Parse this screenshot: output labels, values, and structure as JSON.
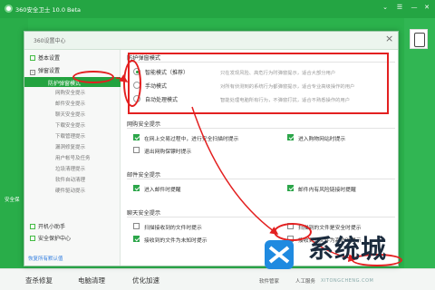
{
  "app": {
    "title": "360安全卫士",
    "version": "10.0 Beta",
    "titlebar_icons": [
      "chevron-down-icon",
      "menu-icon",
      "minimize-icon",
      "close-icon"
    ]
  },
  "left_strip_text": "安全保",
  "bottombar": {
    "items": [
      "查杀修复",
      "电脑清理",
      "优化加速"
    ],
    "right_items": [
      "软件管家",
      "人工服务"
    ]
  },
  "dialog": {
    "title": "360设置中心",
    "close": "×",
    "footer_link": "恢复所有默认值"
  },
  "sidebar": {
    "items": [
      {
        "label": "基本设置",
        "kind": "group"
      },
      {
        "label": "弹窗设置",
        "kind": "group"
      },
      {
        "label": "防护弹窗模式",
        "kind": "active"
      },
      {
        "label": "网购安全提示",
        "kind": "sub"
      },
      {
        "label": "邮件安全提示",
        "kind": "sub"
      },
      {
        "label": "聊天安全提示",
        "kind": "sub"
      },
      {
        "label": "下载安全提示",
        "kind": "sub"
      },
      {
        "label": "下载管理提示",
        "kind": "sub"
      },
      {
        "label": "漏洞修复提示",
        "kind": "sub"
      },
      {
        "label": "用户帐号及任务",
        "kind": "sub"
      },
      {
        "label": "垃圾清理提示",
        "kind": "sub"
      },
      {
        "label": "软件自动清理",
        "kind": "sub"
      },
      {
        "label": "硬件驱动提示",
        "kind": "sub"
      },
      {
        "label": "开机小助手",
        "kind": "group"
      },
      {
        "label": "安全保护中心",
        "kind": "group"
      }
    ]
  },
  "protection_mode": {
    "title": "防护弹窗模式",
    "options": [
      {
        "label": "智能模式（推荐）",
        "desc": "只在发现风险、高危行为时弹窗提示，适合大部分用户",
        "selected": true
      },
      {
        "label": "手动模式",
        "desc": "对所有侦测到的系统行为都弹窗提示，适合专业高级操作的用户",
        "selected": false
      },
      {
        "label": "自动处理模式",
        "desc": "智能处理电脑所有行为，不弹窗打扰，适合不熟悉操作的用户",
        "selected": false
      }
    ]
  },
  "shopping": {
    "title": "网购安全提示",
    "checks": [
      {
        "label": "在网上交易过程中，进行安全扫描时提示",
        "checked": true
      },
      {
        "label": "进入购物网站时提示",
        "checked": true
      },
      {
        "label": "退出网购保镖时提示",
        "checked": false
      }
    ]
  },
  "mail": {
    "title": "邮件安全提示",
    "checks": [
      {
        "label": "进入邮件时提醒",
        "checked": true
      },
      {
        "label": "邮件内有风险链接时提醒",
        "checked": true
      }
    ]
  },
  "chat": {
    "title": "聊天安全提示",
    "checks": [
      {
        "label": "扫描接收到的文件时提示",
        "checked": false
      },
      {
        "label": "扫描到的文件是安全时提示",
        "checked": false
      },
      {
        "label": "接收到的文件为未知时提示",
        "checked": true
      },
      {
        "label": "接收到的文件为高危时提示",
        "checked": false
      }
    ]
  },
  "watermark": {
    "text": "系统城",
    "url": "XITONGCHENG.COM"
  },
  "colors": {
    "brand_green": "#2bb24c",
    "highlight_red": "#e32020",
    "active_item": "#23a33f"
  }
}
